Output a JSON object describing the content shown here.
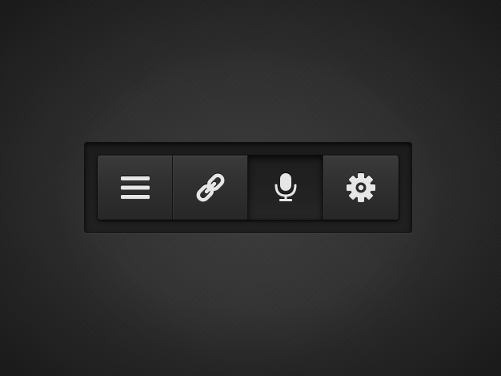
{
  "toolbar": {
    "buttons": [
      {
        "id": "menu",
        "icon": "menu-icon"
      },
      {
        "id": "link",
        "icon": "link-icon"
      },
      {
        "id": "microphone",
        "icon": "microphone-icon",
        "active": true
      },
      {
        "id": "settings",
        "icon": "gear-icon"
      }
    ]
  },
  "colors": {
    "background": "#2b2b2b",
    "button": "#303030",
    "button_active": "#222222",
    "icon": "#e4e4e4"
  }
}
